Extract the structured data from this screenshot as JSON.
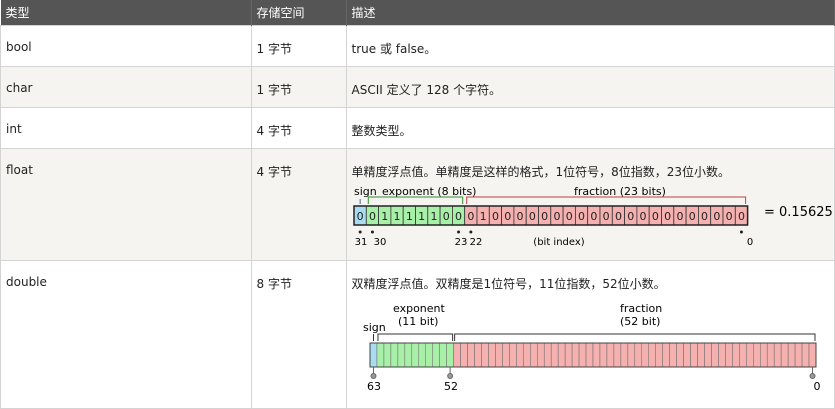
{
  "headers": [
    "类型",
    "存储空间",
    "描述"
  ],
  "rows": [
    {
      "type": "bool",
      "size": "1 字节",
      "desc": "true 或 false。"
    },
    {
      "type": "char",
      "size": "1 字节",
      "desc": "ASCII 定义了 128 个字符。"
    },
    {
      "type": "int",
      "size": "4 字节",
      "desc": "整数类型。"
    },
    {
      "type": "float",
      "size": "4 字节",
      "desc": "单精度浮点值。单精度是这样的格式，1位符号，8位指数，23位小数。"
    },
    {
      "type": "double",
      "size": "8 字节",
      "desc": "双精度浮点值。双精度是1位符号，11位指数，52位小数。"
    }
  ],
  "float_diagram": {
    "sign_label": "sign",
    "exponent_label": "exponent (8 bits)",
    "fraction_label": "fraction (23 bits)",
    "bits": [
      "0",
      "0",
      "1",
      "1",
      "1",
      "1",
      "1",
      "0",
      "0",
      "0",
      "1",
      "0",
      "0",
      "0",
      "0",
      "0",
      "0",
      "0",
      "0",
      "0",
      "0",
      "0",
      "0",
      "0",
      "0",
      "0",
      "0",
      "0",
      "0",
      "0",
      "0",
      "0"
    ],
    "result": "= 0.15625",
    "idx_31": "31",
    "idx_30": "30",
    "idx_23": "23",
    "idx_22": "22",
    "bit_index_label": "(bit index)",
    "idx_0": "0",
    "colors": {
      "sign": "#a8dcf0",
      "exponent": "#a8f0a8",
      "fraction": "#f5b0b0",
      "bracket": "#c04040"
    }
  },
  "double_diagram": {
    "sign_label": "sign",
    "exponent_label": "exponent",
    "exponent_sub": "(11 bit)",
    "fraction_label": "fraction",
    "fraction_sub": "(52 bit)",
    "idx_63": "63",
    "idx_52": "52",
    "idx_0": "0",
    "colors": {
      "sign": "#a8dcf0",
      "exponent": "#a8f0a8",
      "fraction": "#f5b0b0"
    }
  }
}
